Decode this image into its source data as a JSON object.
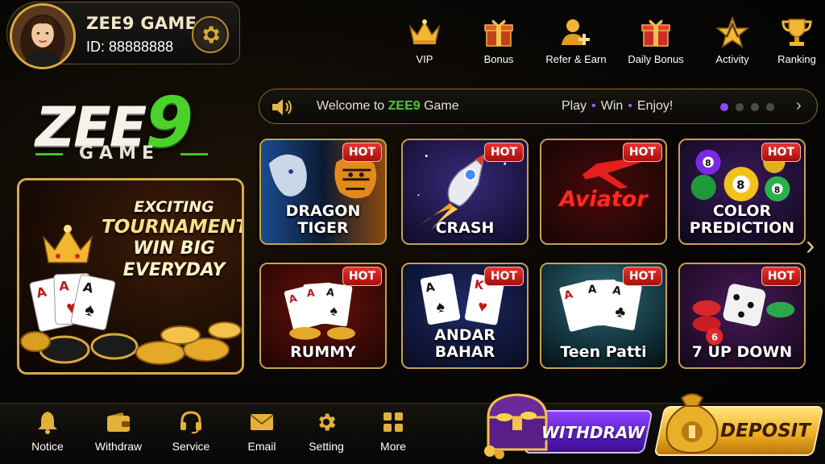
{
  "profile": {
    "name": "ZEE9 GAME",
    "id": "ID: 88888888"
  },
  "top_nav": [
    {
      "label": "VIP",
      "icon": "crown-icon"
    },
    {
      "label": "Bonus",
      "icon": "gift-box-icon"
    },
    {
      "label": "Refer & Earn",
      "icon": "user-add-icon"
    },
    {
      "label": "Daily Bonus",
      "icon": "gift-box-icon"
    },
    {
      "label": "Activity",
      "icon": "star-badge-icon"
    },
    {
      "label": "Ranking",
      "icon": "trophy-icon"
    }
  ],
  "logo": {
    "main": "ZEE",
    "nine": "9",
    "sub": "GAME"
  },
  "promo": {
    "line1": "EXCITING",
    "line2": "TOURNAMENTS",
    "line3": "WIN BIG",
    "line4": "EVERYDAY"
  },
  "marquee": {
    "prefix": "Welcome to ",
    "highlight": "ZEE9",
    "suffix": " Game",
    "right_1": "Play",
    "right_2": "Win",
    "right_3": "Enjoy!",
    "sep": "•",
    "next": "›"
  },
  "hot_badge": "HOT",
  "games": [
    {
      "line1": "DRAGON",
      "line2": "TIGER"
    },
    {
      "line1": "CRASH",
      "line2": ""
    },
    {
      "line1": "Aviator",
      "line2": ""
    },
    {
      "line1": "COLOR",
      "line2": "PREDICTION"
    },
    {
      "line1": "RUMMY",
      "line2": ""
    },
    {
      "line1": "ANDAR",
      "line2": "BAHAR"
    },
    {
      "line1": "Teen Patti",
      "line2": ""
    },
    {
      "line1": "7 UP DOWN",
      "line2": ""
    }
  ],
  "side_arrow": "›",
  "bottom_nav": [
    {
      "label": "Notice",
      "icon": "bell-icon"
    },
    {
      "label": "Withdraw",
      "icon": "wallet-icon"
    },
    {
      "label": "Service",
      "icon": "headset-icon"
    },
    {
      "label": "Email",
      "icon": "envelope-icon"
    },
    {
      "label": "Setting",
      "icon": "gear-icon"
    },
    {
      "label": "More",
      "icon": "grid-icon"
    }
  ],
  "actions": {
    "withdraw": "WITHDRAW",
    "deposit": "DEPOSIT"
  },
  "colors": {
    "gold": "#d6a94a",
    "green": "#44d126",
    "purple": "#7a2cf0",
    "hot_red": "#d9231f"
  }
}
